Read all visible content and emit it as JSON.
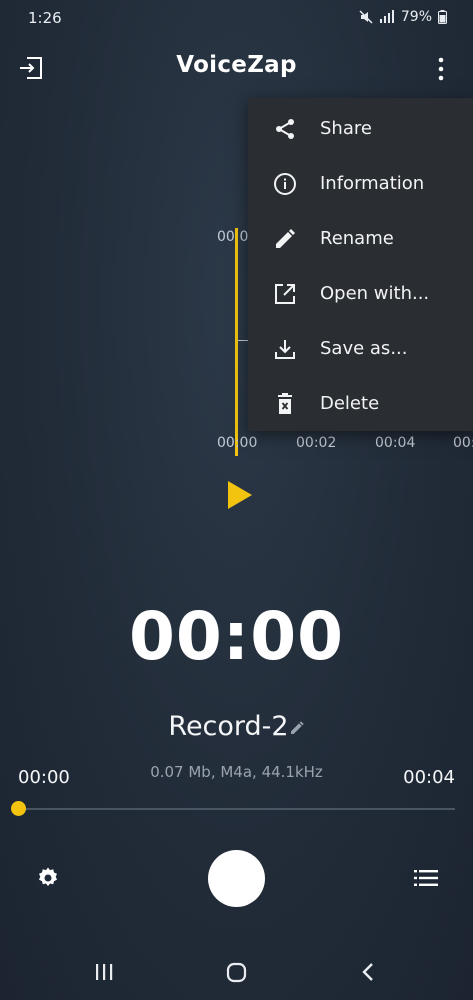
{
  "status_bar": {
    "time": "1:26",
    "battery": "79%"
  },
  "app_bar": {
    "title": "VoiceZap"
  },
  "waveform": {
    "top_label": "00:0",
    "ticks": [
      "00:00",
      "00:02",
      "00:04",
      "00:0"
    ]
  },
  "menu": {
    "items": [
      {
        "label": "Share",
        "icon": "share-icon"
      },
      {
        "label": "Information",
        "icon": "info-icon"
      },
      {
        "label": "Rename",
        "icon": "pencil-icon"
      },
      {
        "label": "Open with...",
        "icon": "open-external-icon"
      },
      {
        "label": "Save as...",
        "icon": "download-icon"
      },
      {
        "label": "Delete",
        "icon": "trash-icon"
      }
    ]
  },
  "player": {
    "timer": "00:00",
    "record_name": "Record-2",
    "file_info": "0.07 Mb, M4a, 44.1kHz",
    "time_start": "00:00",
    "time_end": "00:04",
    "progress": 0
  },
  "colors": {
    "accent": "#f2c40f",
    "background": "#222c39",
    "menu_bg": "#2a2d31"
  }
}
